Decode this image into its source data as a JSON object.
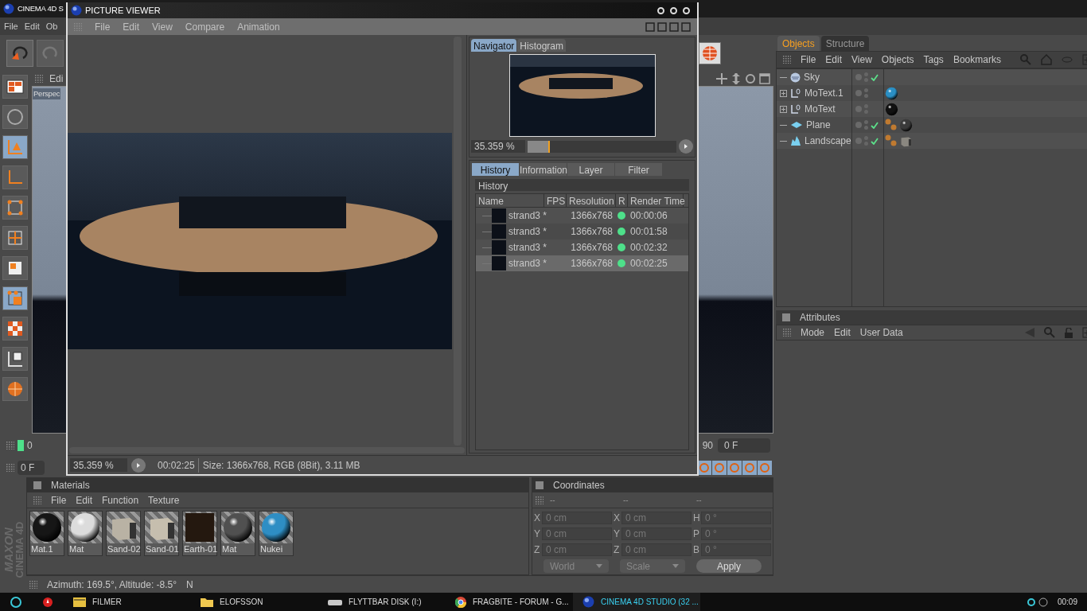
{
  "main_window": {
    "title": "CINEMA 4D S",
    "menu": [
      "File",
      "Edit",
      "Ob"
    ]
  },
  "viewport": {
    "menu": "Edi",
    "camera": "Perspec"
  },
  "timeline": {
    "start_frame": "0",
    "end_frame": "90",
    "left_field": "0 F",
    "right_field": "0 F"
  },
  "picture_viewer": {
    "title": "PICTURE VIEWER",
    "menu": [
      "File",
      "Edit",
      "View",
      "Compare",
      "Animation"
    ],
    "zoom": "35.359 %",
    "time": "00:02:25",
    "info": "Size: 1366x768, RGB (8Bit), 3.11 MB",
    "side_tabs": [
      {
        "label": "Navigator",
        "selected": true
      },
      {
        "label": "Histogram",
        "selected": false
      }
    ],
    "navigator": {
      "zoom": "35.359 %",
      "level": 0.15
    },
    "info_tabs": [
      {
        "label": "History",
        "selected": true
      },
      {
        "label": "Information",
        "selected": false
      },
      {
        "label": "Layer",
        "selected": false
      },
      {
        "label": "Filter",
        "selected": false
      }
    ],
    "history": {
      "title": "History",
      "columns": [
        "Name",
        "FPS",
        "Resolution",
        "R",
        "Render Time"
      ],
      "rows": [
        {
          "name": "strand3 *",
          "resolution": "1366x768",
          "render_time": "00:00:06",
          "selected": false
        },
        {
          "name": "strand3 *",
          "resolution": "1366x768",
          "render_time": "00:01:58",
          "selected": false
        },
        {
          "name": "strand3 *",
          "resolution": "1366x768",
          "render_time": "00:02:32",
          "selected": false
        },
        {
          "name": "strand3 *",
          "resolution": "1366x768",
          "render_time": "00:02:25",
          "selected": true
        }
      ]
    }
  },
  "objects_panel": {
    "tabs": [
      {
        "label": "Objects",
        "selected": true
      },
      {
        "label": "Structure",
        "selected": false
      }
    ],
    "menu": [
      "File",
      "Edit",
      "View",
      "Objects",
      "Tags",
      "Bookmarks"
    ],
    "objects": [
      {
        "name": "Sky",
        "kind": "sky",
        "expandable": false,
        "checked": true
      },
      {
        "name": "MoText.1",
        "kind": "motext",
        "expandable": true,
        "checked": false,
        "tags": [
          {
            "kind": "material",
            "color": "#2a8fc4"
          }
        ]
      },
      {
        "name": "MoText",
        "kind": "motext",
        "expandable": true,
        "checked": false,
        "tags": [
          {
            "kind": "material",
            "color": "#111111"
          }
        ]
      },
      {
        "name": "Plane",
        "kind": "plane",
        "expandable": false,
        "checked": true,
        "tags": [
          {
            "kind": "phong"
          },
          {
            "kind": "material",
            "color": "#3a3a3a"
          }
        ]
      },
      {
        "name": "Landscape",
        "kind": "landscape",
        "expandable": false,
        "checked": true,
        "tags": [
          {
            "kind": "phong"
          },
          {
            "kind": "cube",
            "color": "#8a8780"
          }
        ]
      }
    ]
  },
  "attributes_panel": {
    "title": "Attributes",
    "menu": [
      "Mode",
      "Edit",
      "User Data"
    ]
  },
  "materials_panel": {
    "title": "Materials",
    "menu": [
      "File",
      "Edit",
      "Function",
      "Texture"
    ],
    "materials": [
      {
        "name": "Mat.1",
        "kind": "sphere",
        "color": "#161616"
      },
      {
        "name": "Mat",
        "kind": "sphere",
        "color": "#dcdcdc"
      },
      {
        "name": "Sand-02",
        "kind": "cube",
        "color": "#b9b2a4"
      },
      {
        "name": "Sand-01",
        "kind": "cube",
        "color": "#c6beae"
      },
      {
        "name": "Earth-01",
        "kind": "flat",
        "color": "#24180f"
      },
      {
        "name": "Mat",
        "kind": "sphere",
        "color": "#505050"
      },
      {
        "name": "Nukei",
        "kind": "sphere",
        "color": "#2e8ec4"
      }
    ]
  },
  "coordinates_panel": {
    "title": "Coordinates",
    "headers": [
      "--",
      "--",
      "--"
    ],
    "columns": [
      [
        {
          "axis": "X",
          "value": "0 cm"
        },
        {
          "axis": "Y",
          "value": "0 cm"
        },
        {
          "axis": "Z",
          "value": "0 cm"
        }
      ],
      [
        {
          "axis": "X",
          "value": "0 cm"
        },
        {
          "axis": "Y",
          "value": "0 cm"
        },
        {
          "axis": "Z",
          "value": "0 cm"
        }
      ],
      [
        {
          "axis": "H",
          "value": "0 °"
        },
        {
          "axis": "P",
          "value": "0 °"
        },
        {
          "axis": "B",
          "value": "0 °"
        }
      ]
    ],
    "dropdowns": [
      "World",
      "Scale"
    ],
    "apply": "Apply"
  },
  "status_bar": {
    "text": "Azimuth: 169.5°, Altitude: -8.5°",
    "suffix": "N"
  },
  "logo": [
    "MAXON",
    "CINEMA 4D"
  ],
  "taskbar": {
    "items": [
      {
        "label": "FILMER",
        "kind": "film",
        "selected": false
      },
      {
        "label": "ELOFSSON",
        "kind": "folder",
        "selected": false
      },
      {
        "label": "FLYTTBAR DISK (I:)",
        "kind": "drive",
        "selected": false
      },
      {
        "label": "FRAGBITE - FORUM - G...",
        "kind": "browser",
        "selected": false
      },
      {
        "label": "CINEMA 4D STUDIO (32 ...",
        "kind": "c4d",
        "selected": true
      }
    ],
    "clock": "00:09"
  }
}
